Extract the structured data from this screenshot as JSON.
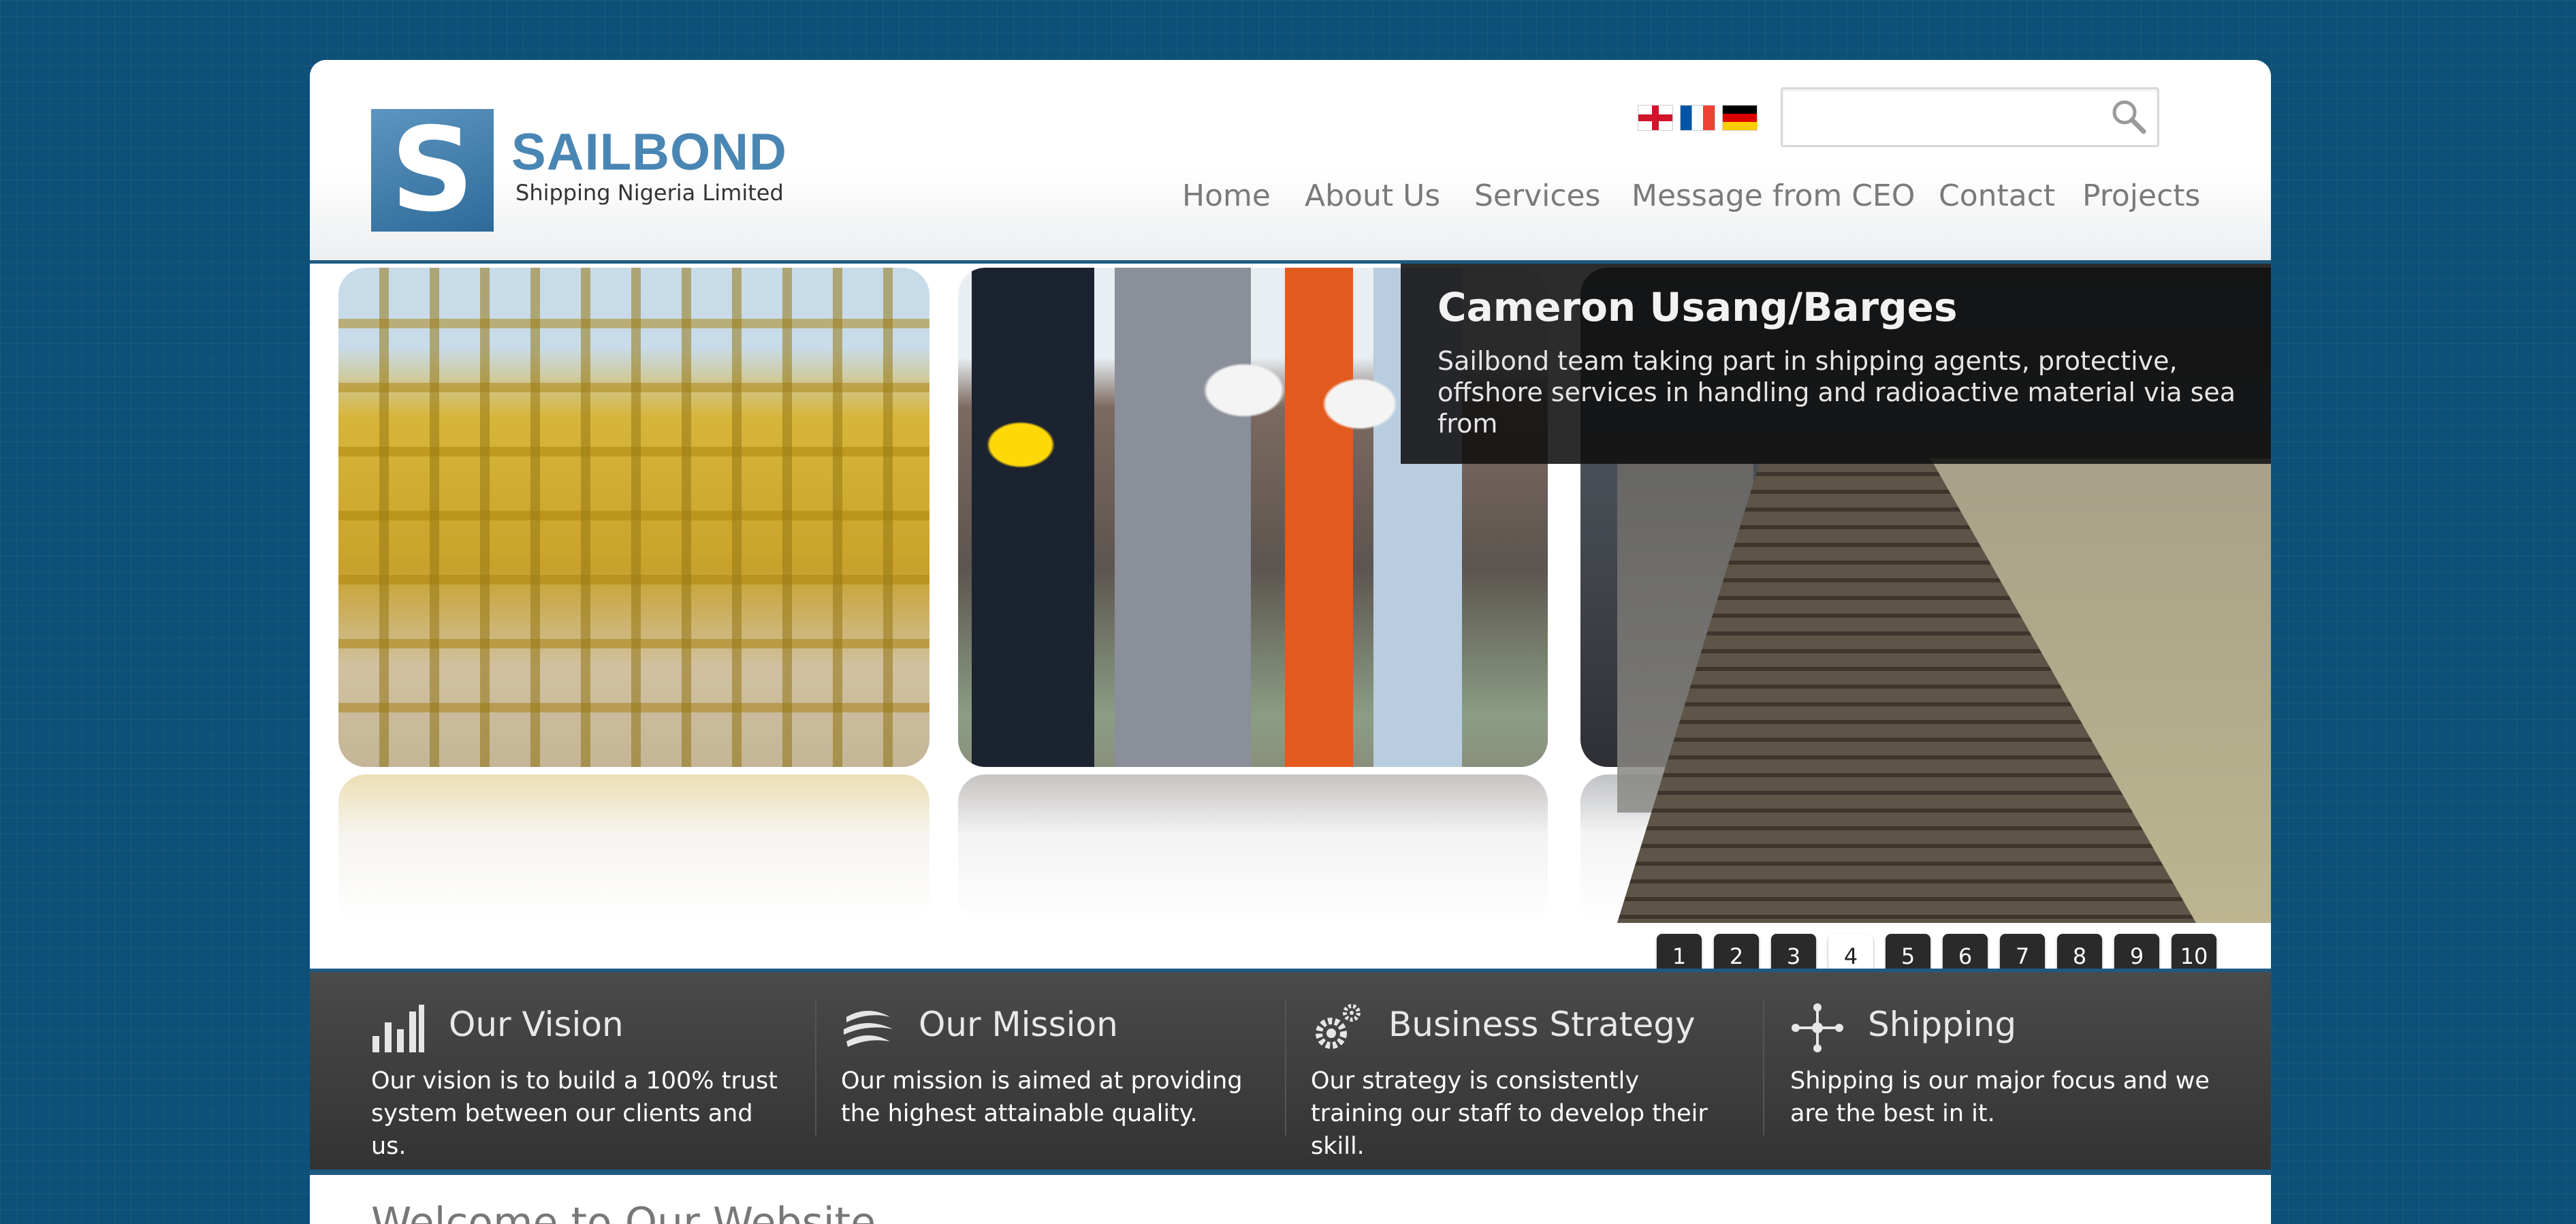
{
  "brand": {
    "name": "SAILBOND",
    "subtitle": "Shipping Nigeria Limited",
    "logo_letter": "S",
    "color": "#4a86b3"
  },
  "languages": [
    {
      "code": "en",
      "icon": "flag-england-icon"
    },
    {
      "code": "fr",
      "icon": "flag-france-icon"
    },
    {
      "code": "de",
      "icon": "flag-germany-icon"
    }
  ],
  "search": {
    "placeholder": "",
    "value": "",
    "icon": "search-icon"
  },
  "nav": [
    "Home",
    "About Us",
    "Services",
    "Message from CEO",
    "Contact",
    "Projects"
  ],
  "slider": {
    "caption_title": "Cameron Usang/Barges",
    "caption_text": "Sailbond team taking part in shipping agents, protective, offshore services in handling and radioactive material via sea from",
    "pages": [
      "1",
      "2",
      "3",
      "4",
      "5",
      "6",
      "7",
      "8",
      "9",
      "10"
    ],
    "active_page": "4"
  },
  "features": [
    {
      "icon": "bar-chart-icon",
      "title": "Our Vision",
      "text": "Our vision is to build a 100% trust system between our clients and us."
    },
    {
      "icon": "globe-icon",
      "title": "Our Mission",
      "text": "Our mission is aimed at providing the highest attainable quality."
    },
    {
      "icon": "gears-icon",
      "title": "Business Strategy",
      "text": "Our strategy is consistently training our staff to develop their skill."
    },
    {
      "icon": "network-icon",
      "title": "Shipping",
      "text": "Shipping is our major focus and we are the best in it."
    }
  ],
  "welcome": "Welcome to Our Website",
  "colors": {
    "background": "#0d5078",
    "accent": "#1e5a82",
    "band": "#3a3a3a"
  }
}
